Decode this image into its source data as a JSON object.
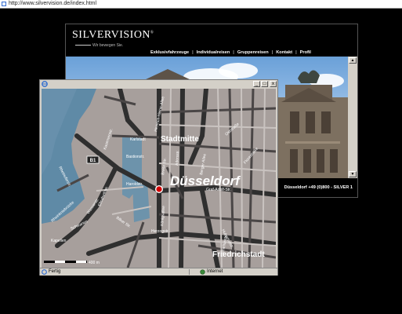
{
  "browser": {
    "url": "http://www.silvervision.de/index.html"
  },
  "site": {
    "logo": "SILVERVISION",
    "logo_mark": "®",
    "tagline": "Wir bewegen Sie.",
    "nav": [
      "Exklusivfahrzeuge",
      "Individualreisen",
      "Gruppenreisen",
      "Kontakt",
      "Profil"
    ],
    "phone": "Düsseldorf +49 (0)800 - SILVER 1"
  },
  "popup": {
    "title_buttons": [
      "_",
      "□",
      "x"
    ],
    "status_text": "Fertig",
    "zone_text": "Internet"
  },
  "map": {
    "city": "Düsseldorf",
    "districts": {
      "stadtmitte": "Stadtmitte",
      "friedrichstadt": "Friedrichstadt"
    },
    "road_badge": "B1",
    "scale_label": "400 m",
    "streets": {
      "heinrich_heine": "Heinrich-Heine-Allee",
      "oststr_n": "Oststraße",
      "kasernen": "Kasernenstr.",
      "breite": "Breite Str.",
      "berger": "Berger Allee",
      "graf_adolf": "Graf-Adolf-Str.",
      "harold": "Haroldstr.",
      "herzog": "Herzogstr.",
      "corneliusstr": "Corneliusstr.",
      "hubertus": "Hubertusstr.",
      "rheinkniebruecke": "Rheinkniebrücke",
      "schwanen": "Schwanen",
      "bilker": "Bilker Str.",
      "konigsallee": "Königsallee",
      "elisabeth": "Elisabethstr.",
      "karlstr": "Karlstadt",
      "bastion": "Bastionstr.",
      "adersstr": "Adersstr.",
      "kapellen": "Kapellen",
      "florastr": "Florastraße",
      "rheinufer": "Rheinuferstr.",
      "wasser": "Wasserstr."
    }
  }
}
